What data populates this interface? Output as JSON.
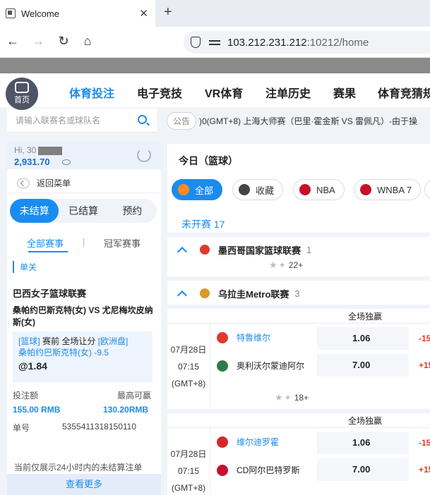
{
  "browser": {
    "tab_title": "Welcome",
    "close_glyph": "✕",
    "new_tab_glyph": "+",
    "url_host": "103.212.231.212",
    "url_rest": ":10212/home",
    "back_glyph": "←",
    "forward_glyph": "→",
    "reload_glyph": "↻",
    "home_glyph": "⌂"
  },
  "topnav": {
    "home_label": "首页",
    "items": [
      "体育投注",
      "电子竞技",
      "VR体育",
      "注单历史",
      "赛果",
      "体育竞猜规"
    ]
  },
  "search": {
    "placeholder": "请输入联赛名或球队名"
  },
  "notice": {
    "badge": "公告",
    "text": ")0(GMT+8) 上海大师赛（巴里·霍金斯 VS 雷佩凡）-由于操"
  },
  "account": {
    "greeting": "Hi, 30",
    "balance": "2,931.70",
    "back_label": "返回菜单"
  },
  "bet_status_tabs": [
    "未结算",
    "已结算",
    "预约"
  ],
  "event_tabs": [
    "全部赛事",
    "冠军赛事"
  ],
  "slip": {
    "type": "单关",
    "league": "巴西女子篮球联赛",
    "match": "桑帕约巴斯克特(女) VS 尤尼梅坎皮纳斯(女)",
    "sport_tag": "[篮球]",
    "market": " 赛前 全场让分 ",
    "odds_type": "[欧洲盘]",
    "selection": "桑帕约巴斯克特(女) -9.5",
    "odds": "@1.84",
    "stake_label": "投注额",
    "payout_label": "最高可赢",
    "stake": "155.00 RMB",
    "payout": "130.20RMB",
    "order_label": "单号",
    "order_no": "5355411318150110"
  },
  "footer": {
    "only24": "当前仅展示24小时内的未结算注单",
    "see_more": "查看更多"
  },
  "main": {
    "title": "今日（篮球）",
    "chips": [
      {
        "label": "全部",
        "icon": "grid-icon",
        "color": "#ff8a1f"
      },
      {
        "label": "收藏",
        "icon": "star-icon",
        "color": "#444"
      },
      {
        "label": "NBA",
        "icon": "nba-icon",
        "color": "#c8102e"
      },
      {
        "label": "WNBA 7",
        "icon": "wnba-icon",
        "color": "#c8102e"
      }
    ],
    "not_started": "未开赛 17",
    "leagues": [
      {
        "name": "墨西哥国家篮球联赛",
        "count": "1",
        "flag_color": "#e03a2e",
        "more": "22+"
      },
      {
        "name": "乌拉圭Metro联赛",
        "count": "3",
        "flag_color": "#d89a2b"
      }
    ],
    "market_header": "全场独赢",
    "matches": [
      {
        "date": "07月28日",
        "time": "07:15",
        "tz": "(GMT+8)",
        "home": "特鲁维尔",
        "away": "奥利沃尔蒙迪阿尔",
        "home_odds": "1.06",
        "away_odds": "7.00",
        "home_hcap": "-15",
        "away_hcap": "+15",
        "home_logo": "#e03a2e",
        "away_logo": "#2f7c4a",
        "more": "18+"
      },
      {
        "date": "07月28日",
        "time": "07:15",
        "tz": "(GMT+8)",
        "home": "维尔迪罗霍",
        "away": "CD阿尔巴特罗斯",
        "home_odds": "1.06",
        "away_odds": "7.00",
        "home_hcap": "-15",
        "away_hcap": "+15",
        "home_logo": "#d62828",
        "away_logo": "#c8102e"
      }
    ]
  },
  "colors": {
    "accent": "#1a8cf0",
    "page_bg": "#f0f3f8",
    "handicap": "#e03a2e"
  }
}
